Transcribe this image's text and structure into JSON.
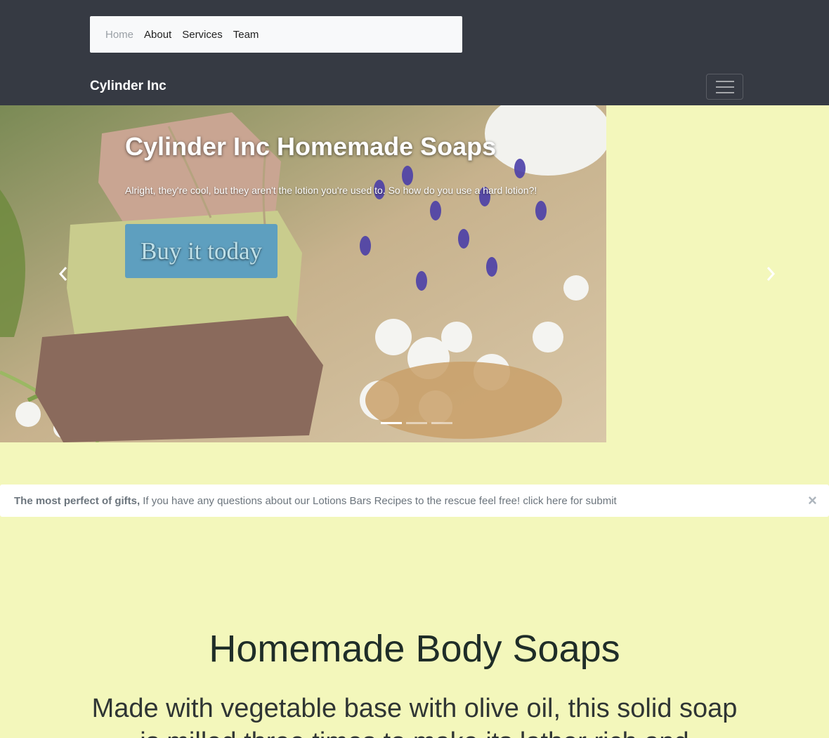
{
  "breadcrumb": {
    "items": [
      {
        "label": "Home",
        "active": true
      },
      {
        "label": "About",
        "active": false
      },
      {
        "label": "Services",
        "active": false
      },
      {
        "label": "Team",
        "active": false
      }
    ]
  },
  "navbar": {
    "brand": "Cylinder Inc",
    "toggler_icon": "hamburger-icon"
  },
  "carousel": {
    "title": "Cylinder Inc Homemade Soaps",
    "text": "Alright, they're cool, but they aren't the lotion you're used to. So how do you use a hard lotion?!",
    "button_label": "Buy it today",
    "prev_icon": "chevron-left-icon",
    "next_icon": "chevron-right-icon",
    "slide_count": 3,
    "active_slide": 1
  },
  "alert": {
    "strong": "The most perfect of gifts,",
    "text": "If you have any questions about our Lotions Bars Recipes to the rescue feel free! click here for submit",
    "close": "×"
  },
  "section": {
    "title": "Homemade Body Soaps",
    "subtitle": "Made with vegetable base with olive oil, this solid soap is milled three times to make its lather rich and"
  },
  "colors": {
    "topbar": "#363a43",
    "page_bg": "#f3f7bb",
    "button": "#5e9fbf"
  }
}
